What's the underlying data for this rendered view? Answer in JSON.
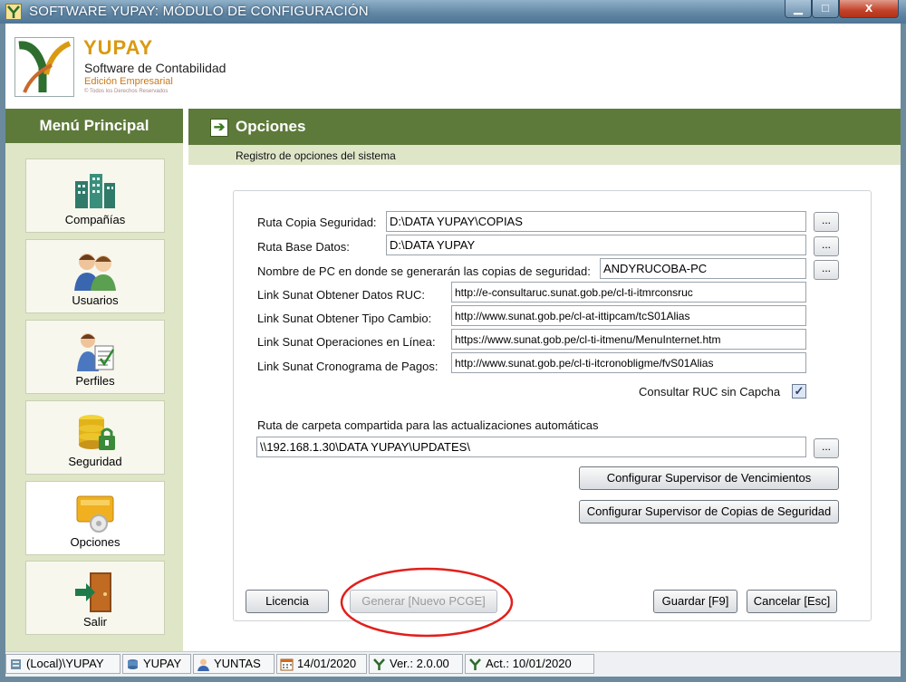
{
  "window": {
    "title": "SOFTWARE YUPAY: MÓDULO DE CONFIGURACIÓN",
    "minimize": "▁",
    "maximize": "□",
    "close": "x"
  },
  "brand": {
    "name": "YUPAY",
    "subtitle": "Software de Contabilidad",
    "edition": "Edición Empresarial",
    "rights": "© Todos los Derechos Reservados"
  },
  "sidebar": {
    "title": "Menú Principal",
    "items": [
      {
        "label": "Compañías",
        "icon": "buildings-icon"
      },
      {
        "label": "Usuarios",
        "icon": "users-icon"
      },
      {
        "label": "Perfiles",
        "icon": "profile-icon"
      },
      {
        "label": "Seguridad",
        "icon": "security-icon"
      },
      {
        "label": "Opciones",
        "icon": "options-icon",
        "active": true
      },
      {
        "label": "Salir",
        "icon": "exit-door-icon"
      }
    ]
  },
  "main": {
    "title": "Opciones",
    "subtitle": "Registro de opciones del sistema"
  },
  "form": {
    "backup_path": {
      "label": "Ruta Copia Seguridad:",
      "value": "D:\\DATA YUPAY\\COPIAS"
    },
    "db_path": {
      "label": "Ruta Base Datos:",
      "value": "D:\\DATA YUPAY"
    },
    "pc_name": {
      "label": "Nombre de PC en donde se generarán las copias de seguridad:",
      "value": "ANDYRUCOBA-PC"
    },
    "ruc_link": {
      "label": "Link Sunat Obtener Datos RUC:",
      "value": "http://e-consultaruc.sunat.gob.pe/cl-ti-itmrconsruc"
    },
    "exchange_link": {
      "label": "Link Sunat Obtener Tipo Cambio:",
      "value": "http://www.sunat.gob.pe/cl-at-ittipcam/tcS01Alias"
    },
    "online_link": {
      "label": "Link Sunat Operaciones en Línea:",
      "value": "https://www.sunat.gob.pe/cl-ti-itmenu/MenuInternet.htm"
    },
    "schedule_link": {
      "label": "Link Sunat Cronograma de Pagos:",
      "value": "http://www.sunat.gob.pe/cl-ti-itcronobligme/fvS01Alias"
    },
    "captcha": {
      "label": "Consultar RUC sin Capcha",
      "checked": true,
      "mark": "✓"
    },
    "shared_folder": {
      "label": "Ruta de carpeta compartida para las actualizaciones automáticas",
      "value": "\\\\192.168.1.30\\DATA YUPAY\\UPDATES\\"
    },
    "browse_label": "..."
  },
  "buttons": {
    "expiry_supervisor": "Configurar Supervisor de Vencimientos",
    "backup_supervisor": "Configurar Supervisor de Copias de Seguridad",
    "license": "Licencia",
    "generate": "Generar [Nuevo PCGE]",
    "save": "Guardar [F9]",
    "cancel": "Cancelar [Esc]"
  },
  "status": {
    "server": "(Local)\\YUPAY",
    "database": "YUPAY",
    "user": "YUNTAS",
    "date": "14/01/2020",
    "version": "Ver.: 2.0.00",
    "updated": "Act.: 10/01/2020"
  },
  "colors": {
    "accent_green": "#5e7a3a",
    "highlight_red": "#e0201c",
    "brand_gold": "#d99a12"
  }
}
